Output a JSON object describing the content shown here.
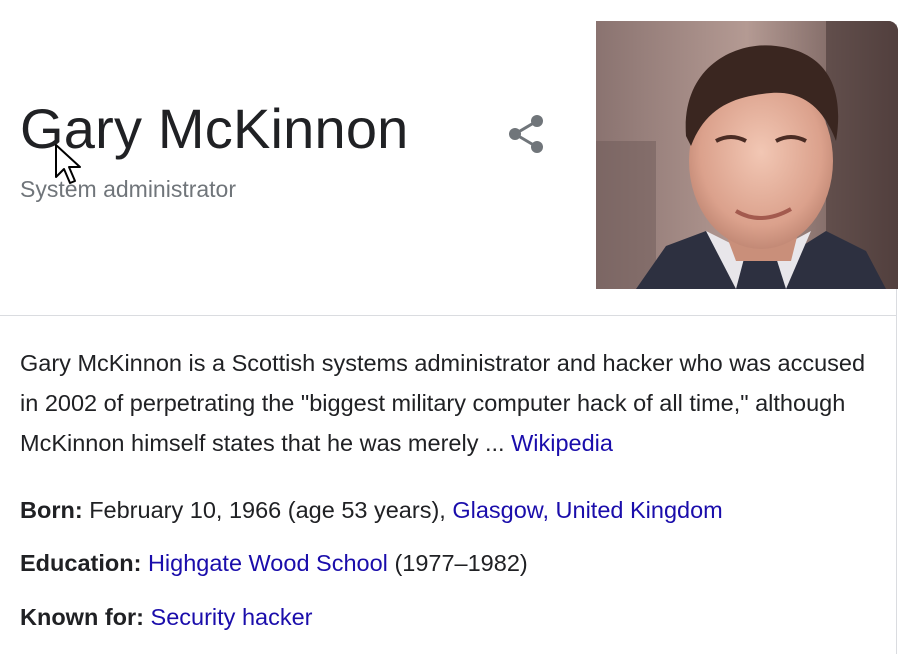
{
  "entity": {
    "name": "Gary McKinnon",
    "subtitle": "System administrator"
  },
  "share_icon": "share-icon",
  "description": {
    "text": "Gary McKinnon is a Scottish systems administrator and hacker who was accused in 2002 of perpetrating the \"biggest military computer hack of all time,\" although McKinnon himself states that he was merely ...",
    "source_label": "Wikipedia"
  },
  "facts": {
    "born": {
      "label": "Born:",
      "value": "February 10, 1966 (age 53 years),",
      "link1": "Glasgow,",
      "link2": "United Kingdom"
    },
    "education": {
      "label": "Education:",
      "link": "Highgate Wood School",
      "value": "(1977–1982)"
    },
    "known_for": {
      "label": "Known for:",
      "link": "Security hacker"
    }
  },
  "colors": {
    "link": "#1a0dab",
    "text": "#202124",
    "secondary": "#70757a",
    "divider": "#dadce0"
  }
}
